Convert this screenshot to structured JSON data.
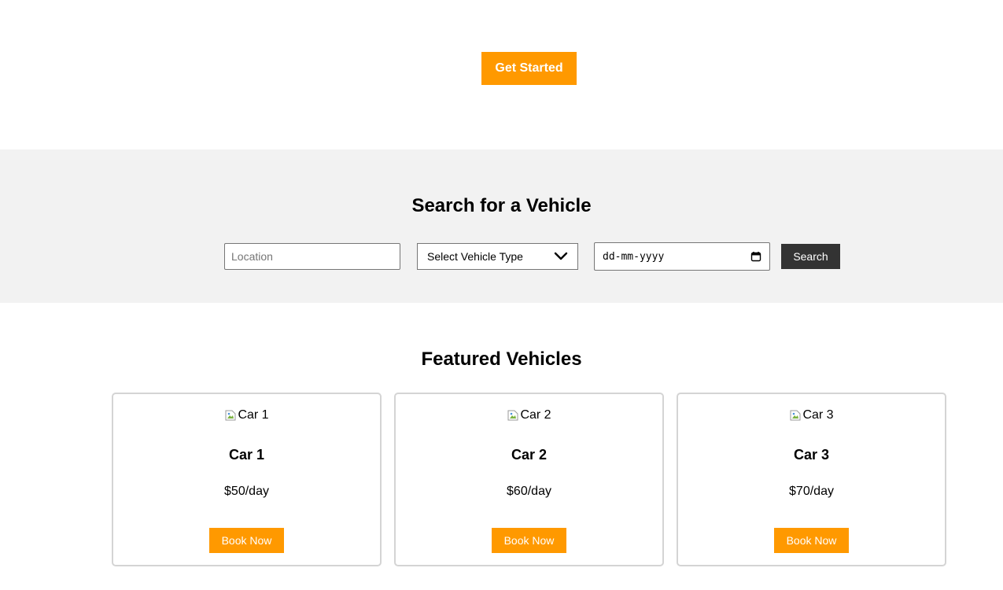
{
  "hero": {
    "cta_label": "Get Started",
    "accent_color": "#ff9900"
  },
  "search": {
    "title": "Search for a Vehicle",
    "location_placeholder": "Location",
    "location_value": "",
    "vehicle_type_selected": "Select Vehicle Type",
    "date_value": "dd-mm-yyyy",
    "search_label": "Search",
    "icons": [
      "chevron-down-icon",
      "calendar-icon"
    ]
  },
  "featured": {
    "title": "Featured Vehicles",
    "cars": [
      {
        "img_alt": "Car 1",
        "name": "Car 1",
        "price": "$50/day",
        "book_label": "Book Now"
      },
      {
        "img_alt": "Car 2",
        "name": "Car 2",
        "price": "$60/day",
        "book_label": "Book Now"
      },
      {
        "img_alt": "Car 3",
        "name": "Car 3",
        "price": "$70/day",
        "book_label": "Book Now"
      }
    ]
  }
}
